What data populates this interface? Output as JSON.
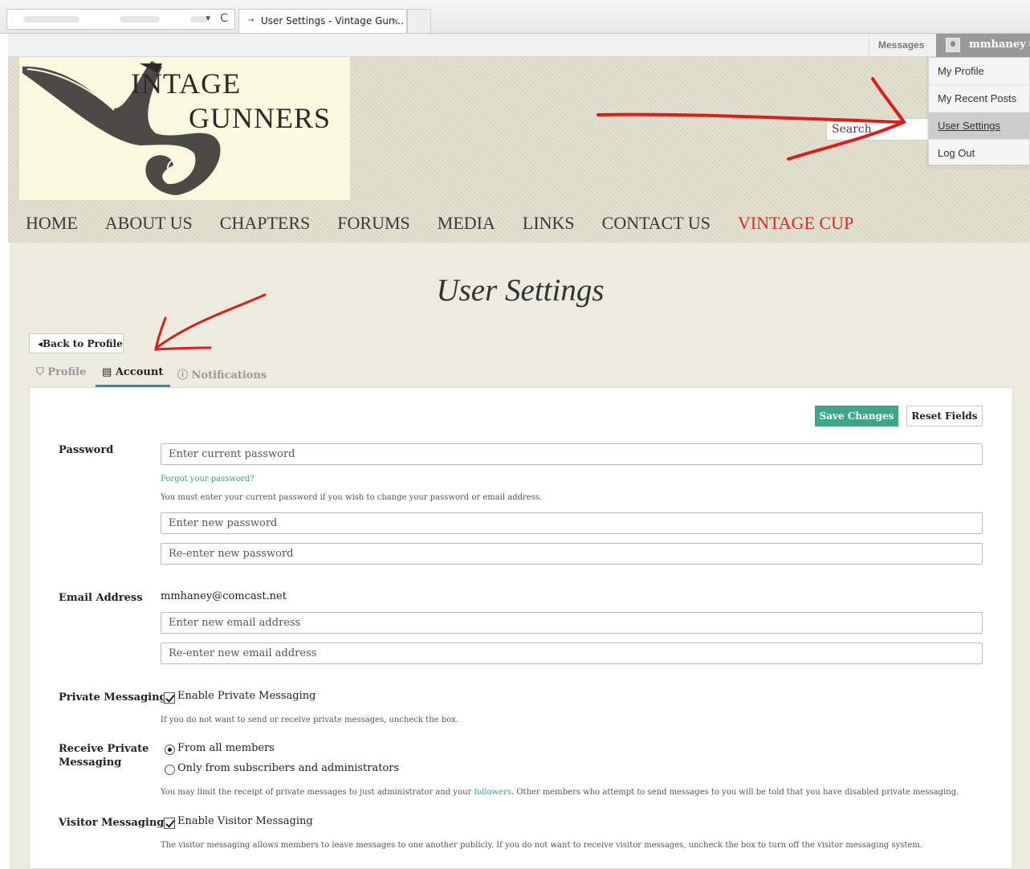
{
  "browser": {
    "tab_title": "User Settings - Vintage Gun...",
    "tab_close": "×",
    "dropdown_glyph": "▾",
    "reload_glyph": "C"
  },
  "adminbar": {
    "messages": "Messages",
    "username": "mmhaney",
    "close": "×"
  },
  "user_menu": {
    "items": [
      {
        "label": "My Profile"
      },
      {
        "label": "My Recent Posts"
      },
      {
        "label": "User Settings",
        "active": true
      },
      {
        "label": "Log Out"
      }
    ]
  },
  "logo": {
    "line1": "INTAGE",
    "line2": "GUNNERS"
  },
  "search": {
    "placeholder": "Search"
  },
  "nav": {
    "items": [
      {
        "label": "HOME"
      },
      {
        "label": "ABOUT US"
      },
      {
        "label": "CHAPTERS"
      },
      {
        "label": "FORUMS"
      },
      {
        "label": "MEDIA"
      },
      {
        "label": "LINKS"
      },
      {
        "label": "CONTACT US"
      },
      {
        "label": "VINTAGE CUP",
        "color": "#d62a2a"
      }
    ]
  },
  "page": {
    "title": "User Settings",
    "back_button": "◂Back to Profile",
    "tabs": [
      {
        "label": "Profile",
        "icon": "user-icon"
      },
      {
        "label": "Account",
        "icon": "id-card-icon",
        "active": true
      },
      {
        "label": "Notifications",
        "icon": "alert-icon"
      }
    ],
    "save_button": "Save Changes",
    "reset_button": "Reset Fields"
  },
  "password": {
    "label": "Password",
    "current_placeholder": "Enter current password",
    "forgot_link": "Forgot your password?",
    "help": "You must enter your current password if you wish to change your password or email address.",
    "new_placeholder": "Enter new password",
    "reenter_placeholder": "Re-enter new password"
  },
  "email": {
    "label": "Email Address",
    "current": "mmhaney@comcast.net",
    "new_placeholder": "Enter new email address",
    "reenter_placeholder": "Re-enter new email address"
  },
  "private_messaging": {
    "label": "Private Messaging",
    "checkbox_label": "Enable Private Messaging",
    "checked": true,
    "help": "If you do not want to send or receive private messages, uncheck the box."
  },
  "receive_private": {
    "label_line1": "Receive Private",
    "label_line2": "Messaging",
    "options": [
      {
        "label": "From all members",
        "selected": true
      },
      {
        "label": "Only from subscribers and administrators",
        "selected": false
      }
    ],
    "help_before": "You may limit the receipt of private messages to just administrator and your ",
    "help_link": "followers",
    "help_after": ". Other members who attempt to send messages to you will be told that you have disabled private messaging."
  },
  "visitor_messaging": {
    "label": "Visitor Messaging",
    "checkbox_label": "Enable Visitor Messaging",
    "checked": true,
    "help": "The visitor messaging allows members to leave messages to one another publicly. If you do not want to receive visitor messages, uncheck the box to turn off the visitor messaging system."
  },
  "colors": {
    "accent": "#3ea58b",
    "tab_underline": "#2e8bb8",
    "annotation_red": "#e01b1b"
  }
}
